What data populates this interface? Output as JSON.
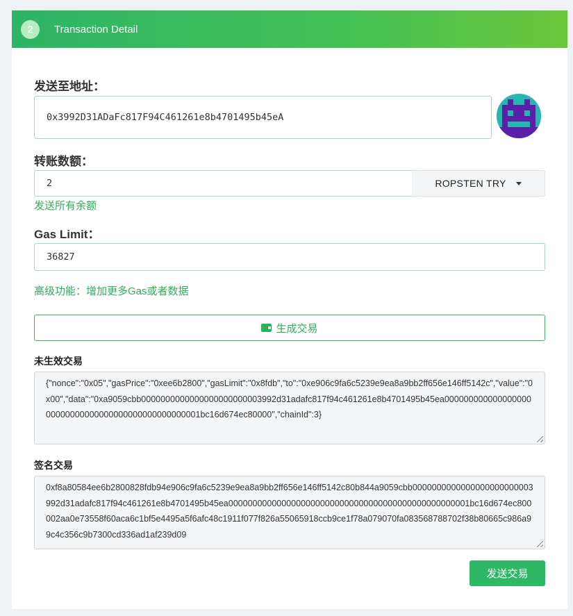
{
  "header": {
    "step": "2",
    "title": "Transaction Detail"
  },
  "to_address": {
    "label": "发送至地址：",
    "value": "0x3992D31ADaFc817F94C461261e8b4701495b45eA"
  },
  "amount": {
    "label": "转账数额：",
    "value": "2",
    "unit": "ROPSTEN TRY",
    "send_all_link": "发送所有余额"
  },
  "gas_limit": {
    "label": "Gas Limit：",
    "value": "36827"
  },
  "advanced_link": "高级功能：增加更多Gas或者数据",
  "generate_button": "生成交易",
  "unsigned_tx": {
    "label": "未生效交易",
    "value": "{\"nonce\":\"0x05\",\"gasPrice\":\"0xee6b2800\",\"gasLimit\":\"0x8fdb\",\"to\":\"0xe906c9fa6c5239e9ea8a9bb2ff656e146ff5142c\",\"value\":\"0x00\",\"data\":\"0xa9059cbb0000000000000000000000003992d31adafc817f94c461261e8b4701495b45ea00000000000000000000000000000000000000000000000001bc16d674ec80000\",\"chainId\":3}"
  },
  "signed_tx": {
    "label": "签名交易",
    "value": "0xf8a80584ee6b2800828fdb94e906c9fa6c5239e9ea8a9bb2ff656e146ff5142c80b844a9059cbb0000000000000000000000003992d31adafc817f94c461261e8b4701495b45ea00000000000000000000000000000000000000000000000001bc16d674ec800002aa0e73558f60aca6c1bf5e4495a5f6afc48c1911f077f826a55065918ccb9ce1f78a079070fa083568788702f38b80665c986a99c4c356c9b7300cd336ad1af239d09"
  },
  "send_button": "发送交易",
  "colors": {
    "accent": "#2eb866",
    "header_gradient_start": "#2eb466",
    "header_gradient_end": "#6cc63c",
    "link": "#2fae5a"
  },
  "icons": {
    "generate": "wallet-icon",
    "unit_dropdown": "caret-down-icon",
    "avatar": "identicon-avatar"
  }
}
